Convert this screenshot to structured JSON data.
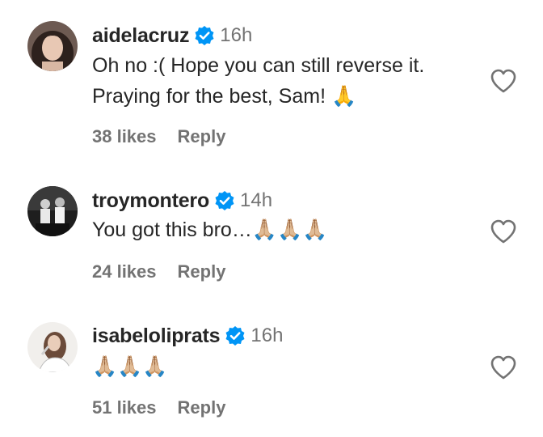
{
  "comments": [
    {
      "username": "aidelacruz",
      "time": "16h",
      "text": "Oh no :( Hope you can still reverse it.\nPraying for the best, Sam! 🙏",
      "likes": "38 likes",
      "reply": "Reply",
      "avatar_icon": "profile-photo-woman-dark-hair"
    },
    {
      "username": "troymontero",
      "time": "14h",
      "text": "You got this bro…🙏🏼🙏🏼🙏🏼",
      "likes": "24 likes",
      "reply": "Reply",
      "avatar_icon": "profile-photo-group-dark"
    },
    {
      "username": "isabeloliprats",
      "time": "16h",
      "text": "🙏🏼🙏🏼🙏🏼",
      "likes": "51 likes",
      "reply": "Reply",
      "avatar_icon": "profile-photo-woman-sketch"
    }
  ],
  "colors": {
    "verified": "#0095F6",
    "muted": "#737373",
    "text": "#262626"
  }
}
